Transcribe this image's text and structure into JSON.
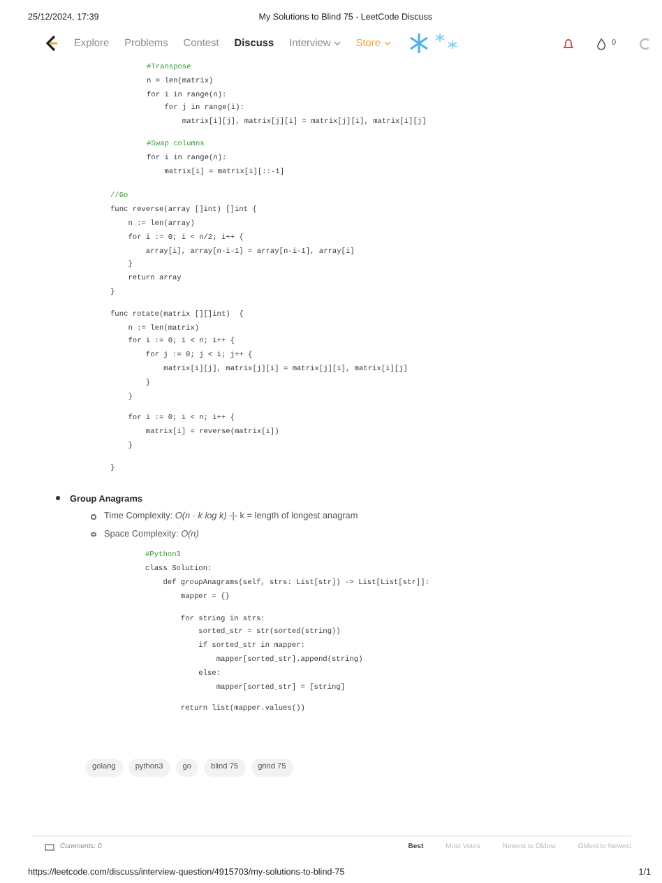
{
  "print_header": {
    "datetime": "25/12/2024, 17:39",
    "title": "My Solutions to Blind 75 - LeetCode Discuss"
  },
  "nav": {
    "items": [
      {
        "label": "Explore",
        "selected": false,
        "kind": "plain"
      },
      {
        "label": "Problems",
        "selected": false,
        "kind": "plain"
      },
      {
        "label": "Contest",
        "selected": false,
        "kind": "plain"
      },
      {
        "label": "Discuss",
        "selected": true,
        "kind": "plain"
      },
      {
        "label": "Interview",
        "selected": false,
        "kind": "dropdown"
      },
      {
        "label": "Store",
        "selected": false,
        "kind": "store"
      }
    ],
    "streak_count": "0"
  },
  "post": {
    "top_code": [
      {
        "kind": "comment",
        "text": "#Transpose"
      },
      {
        "kind": "code",
        "text": "n = len(matrix)"
      },
      {
        "kind": "code",
        "text": "for i in range(n):"
      },
      {
        "kind": "code",
        "text": "    for j in range(i):"
      },
      {
        "kind": "code",
        "text": "        matrix[i][j], matrix[j][i] = matrix[j][i], matrix[i][j]"
      },
      {
        "kind": "blank"
      },
      {
        "kind": "comment",
        "text": "#Swap columns"
      },
      {
        "kind": "code",
        "text": "for i in range(n):"
      },
      {
        "kind": "code",
        "text": "    matrix[i] = matrix[i][::-1]"
      }
    ],
    "go_code": [
      {
        "kind": "comment",
        "text": "//Go"
      },
      {
        "kind": "code",
        "text": "func reverse(array []int) []int {"
      },
      {
        "kind": "code",
        "text": "    n := len(array)"
      },
      {
        "kind": "code",
        "text": "    for i := 0; i < n/2; i++ {"
      },
      {
        "kind": "code",
        "text": "        array[i], array[n-i-1] = array[n-i-1], array[i]"
      },
      {
        "kind": "code",
        "text": "    }"
      },
      {
        "kind": "code",
        "text": "    return array"
      },
      {
        "kind": "code",
        "text": "}"
      },
      {
        "kind": "blank"
      },
      {
        "kind": "code",
        "text": "func rotate(matrix [][]int)  {"
      },
      {
        "kind": "code",
        "text": "    n := len(matrix)"
      },
      {
        "kind": "code",
        "text": "    for i := 0; i < n; i++ {"
      },
      {
        "kind": "code",
        "text": "        for j := 0; j < i; j++ {"
      },
      {
        "kind": "code",
        "text": "            matrix[i][j], matrix[j][i] = matrix[j][i], matrix[i][j]"
      },
      {
        "kind": "code",
        "text": "        }"
      },
      {
        "kind": "code",
        "text": "    }"
      },
      {
        "kind": "blank"
      },
      {
        "kind": "code",
        "text": "    for i := 0; i < n; i++ {"
      },
      {
        "kind": "code",
        "text": "        matrix[i] = reverse(matrix[i])"
      },
      {
        "kind": "code",
        "text": "    }"
      },
      {
        "kind": "blank"
      },
      {
        "kind": "code",
        "text": "}"
      }
    ],
    "sections": [
      {
        "title": "Group Anagrams",
        "details": [
          "Time Complexity: *O(n · k log k)* -|- k = length of longest anagram",
          "Space Complexity: *O(n)*"
        ],
        "code": [
          {
            "kind": "comment",
            "text": "#Python3"
          },
          {
            "kind": "code",
            "text": "class Solution:"
          },
          {
            "kind": "code",
            "text": "    def groupAnagrams(self, strs: List[str]) -> List[List[str]]:"
          },
          {
            "kind": "code",
            "text": "        mapper = {}"
          },
          {
            "kind": "blank"
          },
          {
            "kind": "code",
            "text": "        for string in strs:"
          },
          {
            "kind": "code",
            "text": "            sorted_str = str(sorted(string))"
          },
          {
            "kind": "code",
            "text": "            if sorted_str in mapper:"
          },
          {
            "kind": "code",
            "text": "                mapper[sorted_str].append(string)"
          },
          {
            "kind": "code",
            "text": "            else:"
          },
          {
            "kind": "code",
            "text": "                mapper[sorted_str] = [string]"
          },
          {
            "kind": "blank"
          },
          {
            "kind": "code",
            "text": "        return list(mapper.values())"
          }
        ]
      }
    ],
    "tags": [
      "golang",
      "python3",
      "go",
      "blind 75",
      "grind 75"
    ]
  },
  "comments_bar": {
    "count": "Comments: 0",
    "sorts": [
      {
        "label": "Best",
        "selected": true
      },
      {
        "label": "Most Votes",
        "selected": false
      },
      {
        "label": "Newest to Oldest",
        "selected": false
      },
      {
        "label": "Oldest to Newest",
        "selected": false
      }
    ]
  },
  "print_footer": {
    "url": "https://leetcode.com/discuss/interview-question/4915703/my-solutions-to-blind-75",
    "page": "1/1"
  }
}
